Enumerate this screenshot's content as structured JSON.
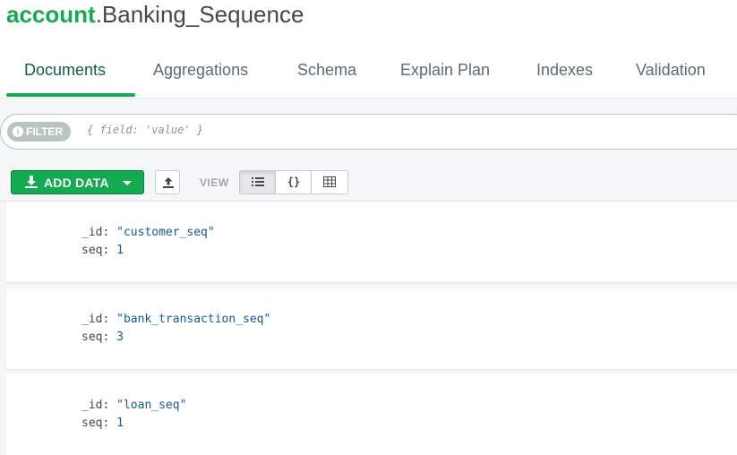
{
  "header": {
    "database": "account",
    "separator": ".",
    "collection": "Banking_Sequence"
  },
  "tabs": [
    {
      "label": "Documents",
      "active": true
    },
    {
      "label": "Aggregations",
      "active": false
    },
    {
      "label": "Schema",
      "active": false
    },
    {
      "label": "Explain Plan",
      "active": false
    },
    {
      "label": "Indexes",
      "active": false
    },
    {
      "label": "Validation",
      "active": false
    }
  ],
  "filter": {
    "pill_label": "FILTER",
    "info_icon": "i",
    "placeholder": "{ field: 'value' }"
  },
  "toolbar": {
    "add_data_label": "ADD DATA",
    "view_label": "VIEW",
    "view_modes": [
      "list",
      "json",
      "table"
    ],
    "active_view": "list",
    "braces_glyph": "{}"
  },
  "documents": [
    {
      "id_key": "_id:",
      "id_value": "\"customer_seq\"",
      "seq_key": "seq:",
      "seq_value": "1"
    },
    {
      "id_key": "_id:",
      "id_value": "\"bank_transaction_seq\"",
      "seq_key": "seq:",
      "seq_value": "3"
    },
    {
      "id_key": "_id:",
      "id_value": "\"loan_seq\"",
      "seq_key": "seq:",
      "seq_value": "1"
    }
  ],
  "colors": {
    "brand_green": "#13aa52",
    "string_blue": "#145a9b"
  }
}
